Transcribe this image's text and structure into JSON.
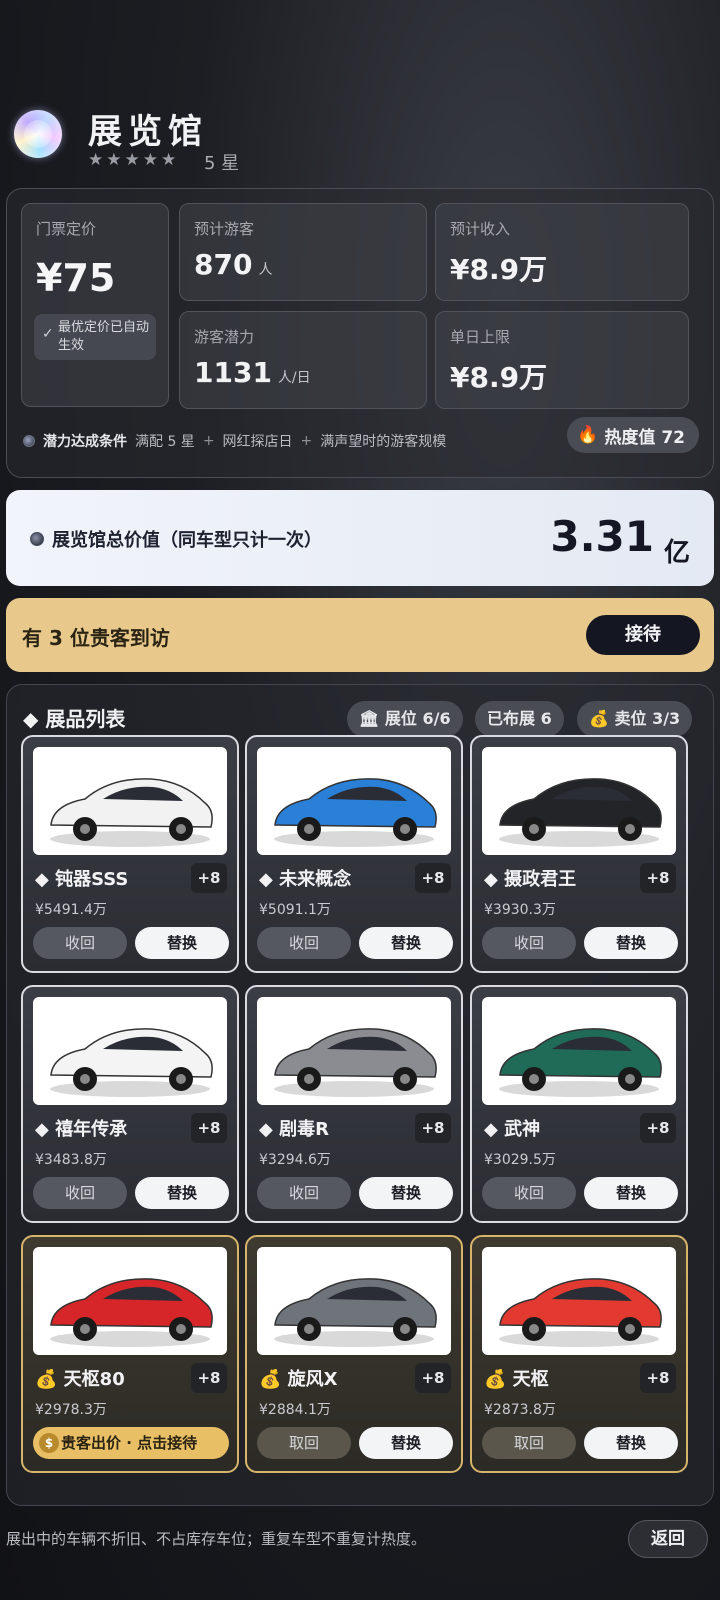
{
  "header": {
    "title": "展览馆",
    "stars": "★★★★★",
    "star_label": "5 星"
  },
  "stats": {
    "ticket_label": "门票定价",
    "ticket_value": "¥75",
    "optimal_note": "最优定价已自动生效",
    "visitors_label": "预计游客",
    "visitors_value": "870",
    "visitors_unit": "人",
    "income_label": "预计收入",
    "income_value": "¥8.9万",
    "potential_label": "游客潜力",
    "potential_value": "1131",
    "potential_unit": "人/日",
    "daily_cap_label": "单日上限",
    "daily_cap_value": "¥8.9万"
  },
  "condition": {
    "label": "潜力达成条件",
    "items": [
      "满配 5 星",
      "网红探店日",
      "满声望时的游客规模"
    ],
    "plus": "+"
  },
  "heat": {
    "icon": "fire-icon",
    "label": "热度值 72"
  },
  "total": {
    "label": "展览馆总价值（同车型只计一次）",
    "value": "3.31",
    "unit": "亿"
  },
  "guest": {
    "text": "有 3 位贵客到访",
    "button": "接待"
  },
  "exhibits": {
    "title": "展品列表",
    "pill_slots": "展位 6/6",
    "pill_displayed": "已布展 6",
    "pill_sold": "卖位 3/3",
    "cars": [
      {
        "name": "钝器SSS",
        "level": "+8",
        "price": "¥5491.4万",
        "btn1": "收回",
        "btn2": "替换",
        "color": "#f2f2f2"
      },
      {
        "name": "未来概念",
        "level": "+8",
        "price": "¥5091.1万",
        "btn1": "收回",
        "btn2": "替换",
        "color": "#2a7fd6"
      },
      {
        "name": "摄政君王",
        "level": "+8",
        "price": "¥3930.3万",
        "btn1": "收回",
        "btn2": "替换",
        "color": "#222428"
      },
      {
        "name": "禧年传承",
        "level": "+8",
        "price": "¥3483.8万",
        "btn1": "收回",
        "btn2": "替换",
        "color": "#f4f4f4"
      },
      {
        "name": "剧毒R",
        "level": "+8",
        "price": "¥3294.6万",
        "btn1": "收回",
        "btn2": "替换",
        "color": "#8a8c91"
      },
      {
        "name": "武神",
        "level": "+8",
        "price": "¥3029.5万",
        "btn1": "收回",
        "btn2": "替换",
        "color": "#1f6b57"
      },
      {
        "name": "天枢80",
        "level": "+8",
        "price": "¥2978.3万",
        "offer": "贵客出价 · 点击接待",
        "color": "#d6262a"
      },
      {
        "name": "旋风X",
        "level": "+8",
        "price": "¥2884.1万",
        "btn1": "取回",
        "btn2": "替换",
        "color": "#6f737a"
      },
      {
        "name": "天枢",
        "level": "+8",
        "price": "¥2873.8万",
        "btn1": "取回",
        "btn2": "替换",
        "color": "#e23a30"
      }
    ]
  },
  "footer": {
    "note": "展出中的车辆不折旧、不占库存车位；重复车型不重复计热度。",
    "back": "返回"
  }
}
